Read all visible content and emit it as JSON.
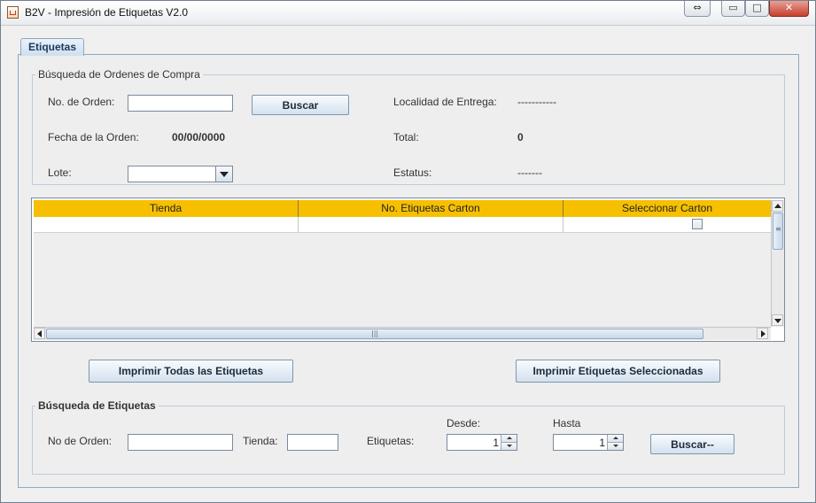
{
  "window": {
    "title": "B2V - Impresión de Etiquetas V2.0",
    "controls": {
      "resize": "⇔",
      "minimize": "▭",
      "maximize": "□",
      "close": "✕"
    }
  },
  "tabs": [
    {
      "label": "Etiquetas"
    }
  ],
  "search_orders": {
    "legend": "Búsqueda de Ordenes de Compra",
    "order_no_label": "No. de Orden:",
    "order_no_value": "",
    "search_button": "Buscar",
    "delivery_label": "Localidad de Entrega:",
    "delivery_value": "-----------",
    "date_label": "Fecha de la Orden:",
    "date_value": "00/00/0000",
    "total_label": "Total:",
    "total_value": "0",
    "lote_label": "Lote:",
    "lote_value": "",
    "status_label": "Estatus:",
    "status_value": "-------"
  },
  "table": {
    "columns": [
      "Tienda",
      "No. Etiquetas Carton",
      "Seleccionar Carton"
    ],
    "rows": [
      {
        "tienda": "",
        "etiquetas": "",
        "seleccionar": false
      }
    ],
    "header_color": "#f6c000"
  },
  "actions": {
    "print_all": "Imprimir Todas las Etiquetas",
    "print_selected": "Imprimir Etiquetas Seleccionadas"
  },
  "search_labels": {
    "legend": "Búsqueda de Etiquetas",
    "order_no_label": "No de Orden:",
    "order_no_value": "",
    "store_label": "Tienda:",
    "store_value": "",
    "labels_label": "Etiquetas:",
    "from_label": "Desde:",
    "from_value": "1",
    "to_label": "Hasta",
    "to_value": "1",
    "search_button": "Buscar--"
  }
}
